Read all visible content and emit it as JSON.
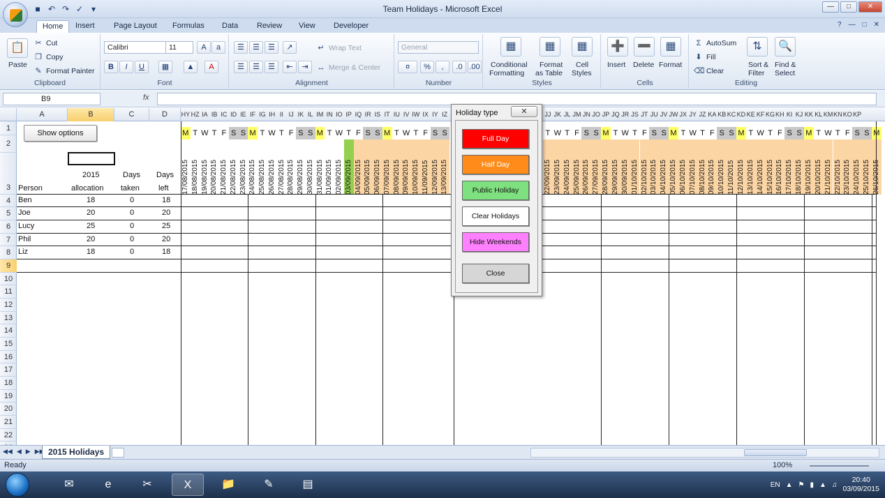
{
  "window": {
    "title": "Team Holidays - Microsoft Excel"
  },
  "tabs": [
    "Home",
    "Insert",
    "Page Layout",
    "Formulas",
    "Data",
    "Review",
    "View",
    "Developer"
  ],
  "ribbon": {
    "clipboard": {
      "label": "Clipboard",
      "paste": "Paste",
      "cut": "Cut",
      "copy": "Copy",
      "format_painter": "Format Painter"
    },
    "font": {
      "label": "Font",
      "name": "Calibri",
      "size": "11"
    },
    "alignment": {
      "label": "Alignment",
      "wrap_text": "Wrap Text",
      "merge_center": "Merge & Center"
    },
    "number": {
      "label": "Number",
      "format": "General"
    },
    "styles": {
      "label": "Styles",
      "conditional": [
        "Conditional",
        "Formatting"
      ],
      "format_table": [
        "Format",
        "as Table"
      ],
      "cell_styles": [
        "Cell",
        "Styles"
      ]
    },
    "cells": {
      "label": "Cells",
      "insert": "Insert",
      "delete": "Delete",
      "format": "Format"
    },
    "editing": {
      "label": "Editing",
      "autosum": "AutoSum",
      "fill": "Fill",
      "clear": "Clear",
      "sort": [
        "Sort &",
        "Filter"
      ],
      "find": [
        "Find &",
        "Select"
      ]
    }
  },
  "formula_bar": {
    "name_box": "B9",
    "fx": "fx",
    "value": ""
  },
  "columns": {
    "left": [
      {
        "letter": "A",
        "width": 73,
        "selected": false
      },
      {
        "letter": "B",
        "width": 67,
        "selected": true
      },
      {
        "letter": "C",
        "width": 50,
        "selected": false
      },
      {
        "letter": "D",
        "width": 45,
        "selected": false
      }
    ],
    "left_date_letters": [
      "HY",
      "HZ",
      "IA",
      "IB",
      "IC",
      "ID",
      "IE",
      "IF",
      "IG",
      "IH",
      "II",
      "IJ",
      "IK",
      "IL",
      "IM",
      "IN",
      "IO",
      "IP",
      "IQ",
      "IR",
      "IS",
      "IT",
      "IU",
      "IV",
      "IW",
      "IX",
      "IY",
      "IZ"
    ],
    "right_date_letters": [
      "JJ",
      "JK",
      "JL",
      "JM",
      "JN",
      "JO",
      "JP",
      "JQ",
      "JR",
      "JS",
      "JT",
      "JU",
      "JV",
      "JW",
      "JX",
      "JY",
      "JZ",
      "KA",
      "KB",
      "KC",
      "KD",
      "KE",
      "KF",
      "KG",
      "KH",
      "KI",
      "KJ",
      "KK",
      "KL",
      "KM",
      "KN",
      "KO",
      "KP"
    ]
  },
  "rows": [
    "1",
    "2",
    "3",
    "4",
    "5",
    "6",
    "7",
    "8",
    "9",
    "10",
    "11",
    "12",
    "13",
    "14",
    "15",
    "16",
    "17",
    "18",
    "19",
    "20",
    "21",
    "22",
    "23"
  ],
  "header": {
    "show_options": "Show options",
    "person": "Person",
    "allocation": [
      "2015",
      "allocation"
    ],
    "taken": [
      "Days",
      "taken"
    ],
    "left": [
      "Days",
      "left"
    ]
  },
  "people": [
    {
      "name": "Ben",
      "allocation": "18",
      "taken": "0",
      "left": "18"
    },
    {
      "name": "Joe",
      "allocation": "20",
      "taken": "0",
      "left": "20"
    },
    {
      "name": "Lucy",
      "allocation": "25",
      "taken": "0",
      "left": "25"
    },
    {
      "name": "Phil",
      "allocation": "20",
      "taken": "0",
      "left": "20"
    },
    {
      "name": "Liz",
      "allocation": "18",
      "taken": "0",
      "left": "18"
    }
  ],
  "calendar": {
    "left_start": "2015-08-17",
    "left_count": 28,
    "right_start": "2015-09-22",
    "right_count": 35,
    "highlight_date": "03/09/2015",
    "orange_from": "2015-09-03",
    "day_letters": [
      "M",
      "T",
      "W",
      "T",
      "F",
      "S",
      "S"
    ],
    "colors": {
      "monday": "#ffff66",
      "weekend": "#c8c8c8",
      "holiday_orange": "#fcd5a5",
      "today_green": "#92d050"
    }
  },
  "dialog": {
    "title": "Holiday type",
    "buttons": [
      {
        "label": "Full Day",
        "color": "#ff0000",
        "text_color": "#ffffff"
      },
      {
        "label": "Half Day",
        "color": "#ff8c1a",
        "text_color": "#ffffff"
      },
      {
        "label": "Public Holiday",
        "color": "#7fe07f",
        "text_color": "#111111"
      },
      {
        "label": "Clear Holidays",
        "color": "#ffffff",
        "text_color": "#111111"
      },
      {
        "label": "Hide Weekends",
        "color": "#ff80ff",
        "text_color": "#111111"
      },
      {
        "label": "Close",
        "color": "#d6d6d6",
        "text_color": "#111111"
      }
    ]
  },
  "sheet": {
    "tab": "2015 Holidays"
  },
  "status": {
    "ready": "Ready",
    "zoom": "100%"
  },
  "taskbar": {
    "lang": "EN",
    "time": "20:40",
    "date": "03/09/2015"
  }
}
